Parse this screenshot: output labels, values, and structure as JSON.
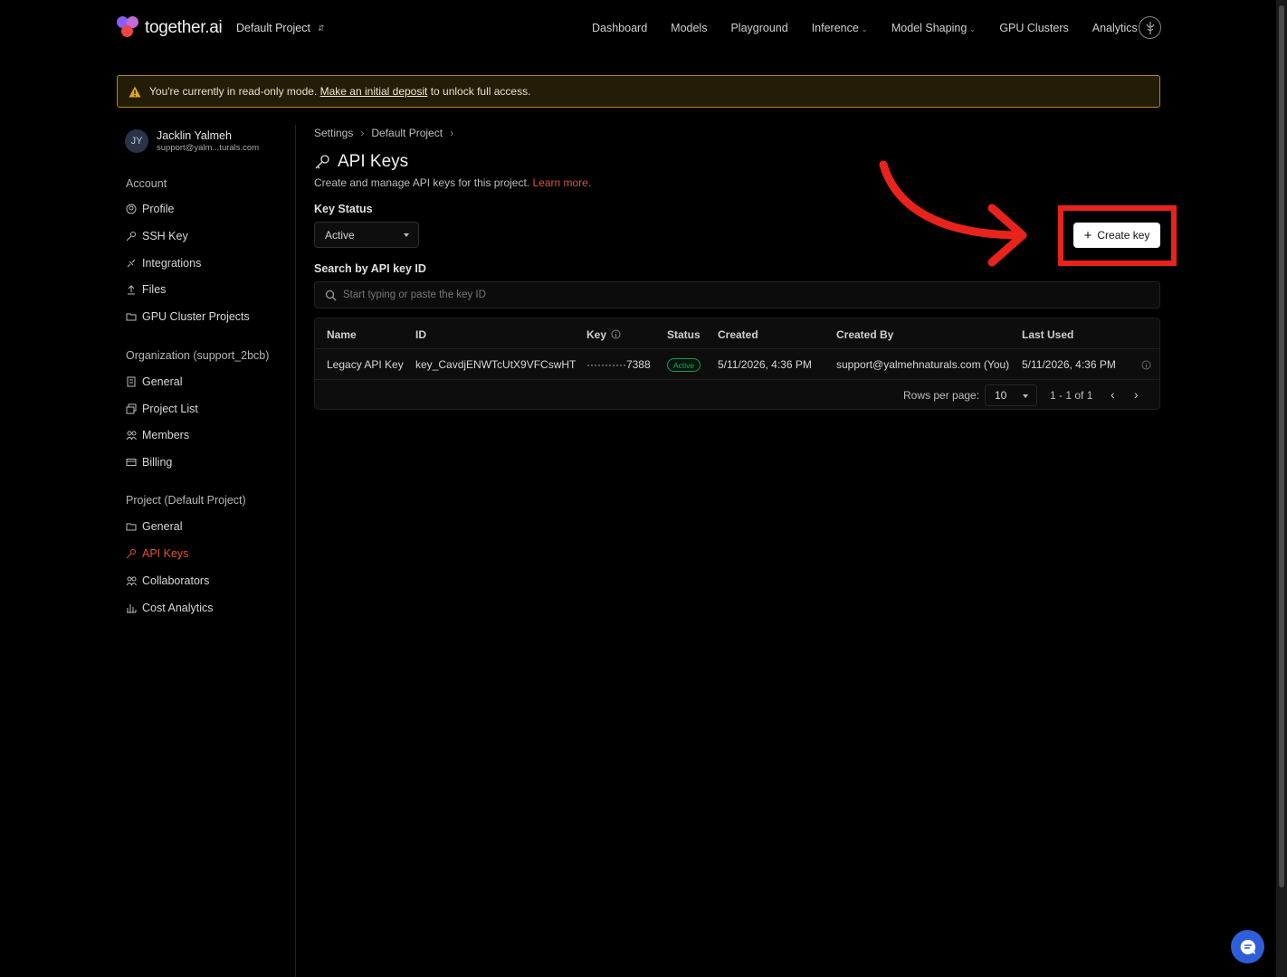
{
  "brand": {
    "name": "together.ai",
    "project": "Default Project"
  },
  "nav": [
    "Dashboard",
    "Models",
    "Playground",
    "Inference",
    "Model Shaping",
    "GPU Clusters",
    "Analytics"
  ],
  "banner": {
    "text_before": "You're currently in read-only mode.",
    "link": "Make an initial deposit",
    "text_after": "to unlock full access."
  },
  "user": {
    "initials": "JY",
    "name": "Jacklin Yalmeh",
    "email": "support@yalm...turals.com"
  },
  "sidebar": {
    "account_title": "Account",
    "account_items": [
      "Profile",
      "SSH Key",
      "Integrations",
      "Files",
      "GPU Cluster Projects"
    ],
    "org_title": "Organization (support_2bcb)",
    "org_items": [
      "General",
      "Project List",
      "Members",
      "Billing"
    ],
    "project_title": "Project (Default Project)",
    "project_items": [
      "General",
      "API Keys",
      "Collaborators",
      "Cost Analytics"
    ]
  },
  "breadcrumb": [
    "Settings",
    "Default Project"
  ],
  "page": {
    "title": "API Keys",
    "subtitle": "Create and manage API keys for this project.",
    "learn_more": "Learn more.",
    "key_status_label": "Key Status",
    "key_status_value": "Active",
    "search_label": "Search by API key ID",
    "search_placeholder": "Start typing or paste the key ID",
    "create_button": "Create key"
  },
  "table": {
    "columns": [
      "Name",
      "ID",
      "Key",
      "Status",
      "Created",
      "Created By",
      "Last Used"
    ],
    "rows": [
      {
        "name": "Legacy API Key",
        "id": "key_CavdjENWTcUtX9VFCswHT",
        "key": "···········7388",
        "status": "Active",
        "created": "5/11/2026, 4:36 PM",
        "created_by": "support@yalmehnaturals.com (You)",
        "last_used": "5/11/2026, 4:36 PM"
      }
    ],
    "rows_per_page_label": "Rows per page:",
    "rows_per_page": "10",
    "range": "1 - 1 of 1"
  },
  "colors": {
    "accent": "#e0533d",
    "annotation": "#e8231c",
    "banner_border": "#b08a1a",
    "active_badge": "#1fa65a"
  }
}
